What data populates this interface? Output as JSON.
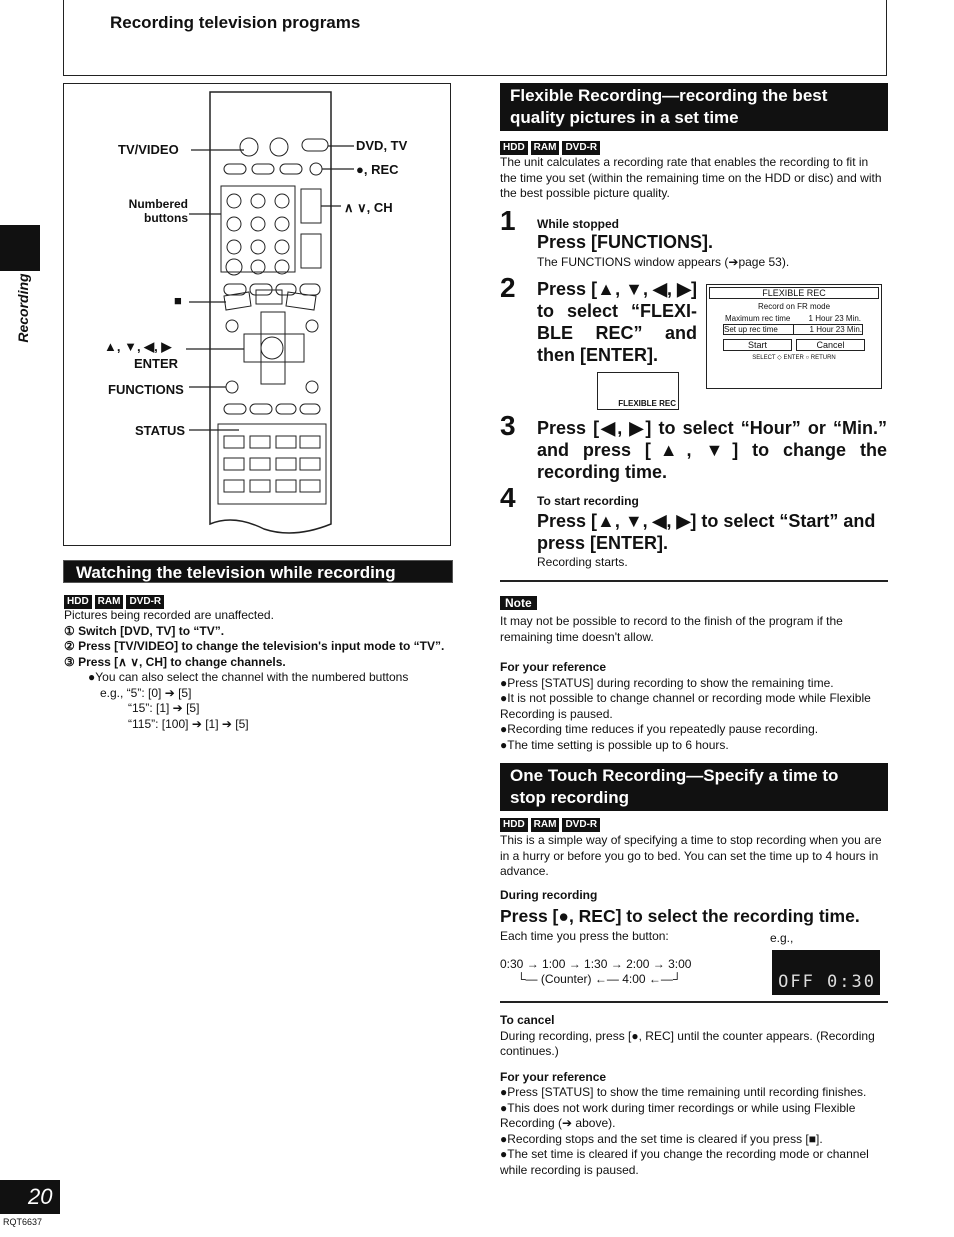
{
  "header": {
    "title": "Recording television programs"
  },
  "side_tab": "Recording",
  "page": {
    "number": "20",
    "code": "RQT6637"
  },
  "badges": [
    "HDD",
    "RAM",
    "DVD-R"
  ],
  "remote": {
    "labels": {
      "tv_video": "TV/VIDEO",
      "dvd_tv": "DVD, TV",
      "rec": "●, REC",
      "numbered": "Numbered buttons",
      "ch": "∧  ∨, CH",
      "stop": "■",
      "arrows": "▲, ▼, ◀, ▶",
      "enter": "ENTER",
      "functions": "FUNCTIONS",
      "status": "STATUS"
    }
  },
  "watching": {
    "heading": "Watching the television while recording",
    "intro": "Pictures being recorded are unaffected.",
    "steps": [
      "① Switch [DVD, TV] to “TV”.",
      "② Press [TV/VIDEO] to change the television's input mode to “TV”.",
      "③ Press [∧ ∨, CH] to change channels."
    ],
    "bullet": "●You can also select the channel with the numbered buttons",
    "examples": [
      "e.g., “5”:   [0] ➔ [5]",
      "“15”:  [1] ➔ [5]",
      "“115”: [100] ➔ [1] ➔ [5]"
    ]
  },
  "flexible": {
    "heading": "Flexible Recording—recording the best quality pictures in a set time",
    "intro": "The unit calculates a recording rate that enables the recording to fit in the time you set (within the remaining time on the HDD or disc) and with the best possible picture quality.",
    "step1": {
      "num": "1",
      "pre": "While stopped",
      "title": "Press [FUNCTIONS].",
      "note": "The FUNCTIONS window appears (➔page 53)."
    },
    "step2": {
      "num": "2",
      "title": "Press [▲, ▼, ◀, ▶] to select “FLEXI-BLE REC” and then [ENTER].",
      "icon_label": "FLEXIBLE REC"
    },
    "screen": {
      "title": "FLEXIBLE REC",
      "mode": "Record on FR mode",
      "max_label": "Maximum rec time",
      "max_value": "1 Hour 23 Min.",
      "set_label": "Set up rec time",
      "set_value": "1 Hour 23 Min.",
      "start": "Start",
      "cancel": "Cancel",
      "select": "SELECT",
      "enter": "ENTER",
      "return": "RETURN"
    },
    "step3": {
      "num": "3",
      "title": "Press [◀, ▶] to select “Hour” or “Min.” and press [▲, ▼] to change the recording time."
    },
    "step4": {
      "num": "4",
      "pre": "To start recording",
      "title": "Press [▲, ▼, ◀, ▶] to select “Start” and press [ENTER].",
      "note": "Recording starts."
    }
  },
  "note": {
    "label": "Note",
    "text": "It may not be possible to record to the finish of the program if the remaining time doesn't allow.",
    "ref_title": "For your reference",
    "refs": [
      "●Press [STATUS] during recording to show the remaining time.",
      "●It is not possible to change channel or recording mode while Flexible Recording is paused.",
      "●Recording time reduces if you repeatedly pause recording.",
      "●The time setting is possible up to 6 hours."
    ]
  },
  "onetouch": {
    "heading": "One Touch Recording—Specify a time to stop recording",
    "intro": "This is a simple way of specifying a time to stop recording when you are in a hurry or before you go to bed. You can set the time up to 4 hours in advance.",
    "pre": "During recording",
    "title": "Press [●, REC] to select the recording time.",
    "each": "Each time you press the button:",
    "eg": "e.g.,",
    "seq1": "0:30 → 1:00 → 1:30 → 2:00 → 3:00",
    "seq2": "└— (Counter) ←— 4:00 ←—┘",
    "display": "OFF  0:30",
    "cancel_title": "To cancel",
    "cancel_text": "During recording, press [●, REC] until the counter appears. (Recording continues.)",
    "ref_title": "For your reference",
    "refs": [
      "●Press [STATUS] to show the time remaining until recording finishes.",
      "●This does not work during timer recordings or while using Flexible Recording (➔ above).",
      "●Recording stops and the set time is cleared if you press [■].",
      "●The set time is cleared if you change the recording mode or channel while recording is paused."
    ]
  }
}
